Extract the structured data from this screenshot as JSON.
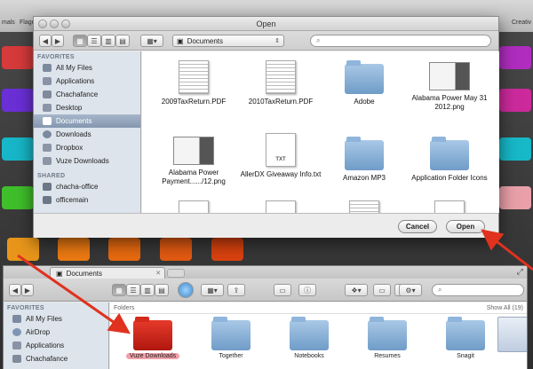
{
  "desktop": {
    "top_labels": [
      "mals",
      "Flage",
      "Creativ"
    ]
  },
  "dialog": {
    "title": "Open",
    "location": "Documents",
    "search_placeholder": "",
    "sidebar": {
      "favorites_header": "FAVORITES",
      "favorites": [
        {
          "label": "All My Files",
          "icon": "all-files-icon",
          "color": "#7c8aa0"
        },
        {
          "label": "Applications",
          "icon": "applications-icon",
          "color": "#8a93a6"
        },
        {
          "label": "Chachafance",
          "icon": "home-icon",
          "color": "#7f8b9a"
        },
        {
          "label": "Desktop",
          "icon": "desktop-icon",
          "color": "#8b95a5"
        },
        {
          "label": "Documents",
          "icon": "documents-icon",
          "color": "#ffffff"
        },
        {
          "label": "Downloads",
          "icon": "downloads-icon",
          "color": "#7c8aa0"
        },
        {
          "label": "Dropbox",
          "icon": "dropbox-icon",
          "color": "#8b95a5"
        },
        {
          "label": "Vuze Downloads",
          "icon": "folder-icon",
          "color": "#8b95a5"
        }
      ],
      "shared_header": "SHARED",
      "shared": [
        {
          "label": "chacha-office",
          "icon": "computer-icon"
        },
        {
          "label": "officemain",
          "icon": "computer-icon"
        }
      ]
    },
    "files": [
      {
        "name": "2009TaxReturn.PDF",
        "kind": "doc"
      },
      {
        "name": "2010TaxReturn.PDF",
        "kind": "doc"
      },
      {
        "name": "Adobe",
        "kind": "folder"
      },
      {
        "name": "Alabama Power May 31 2012.png",
        "kind": "png"
      },
      {
        "name": "Alabama Power Payment....../12.png",
        "kind": "png"
      },
      {
        "name": "AllerDX Giveaway Info.txt",
        "kind": "txt"
      },
      {
        "name": "Amazon MP3",
        "kind": "folder"
      },
      {
        "name": "Application Folder Icons",
        "kind": "folder"
      },
      {
        "name": "",
        "kind": "txt"
      },
      {
        "name": "",
        "kind": "doc"
      },
      {
        "name": "",
        "kind": "doc"
      },
      {
        "name": "",
        "kind": "txt"
      }
    ],
    "txt_badge": "TXT",
    "cancel_label": "Cancel",
    "open_label": "Open"
  },
  "finder": {
    "tab_title": "Documents",
    "section_label": "Folders",
    "show_all": "Show All (19)",
    "sidebar_header": "FAVORITES",
    "sidebar_items": [
      {
        "label": "All My Files",
        "icon": "all-files-icon"
      },
      {
        "label": "AirDrop",
        "icon": "airdrop-icon"
      },
      {
        "label": "Applications",
        "icon": "applications-icon"
      },
      {
        "label": "Chachafance",
        "icon": "home-icon"
      }
    ],
    "folders": [
      {
        "name": "Vuze Downloads",
        "highlight": true
      },
      {
        "name": "Together",
        "highlight": false
      },
      {
        "name": "Notebooks",
        "highlight": false
      },
      {
        "name": "Resumes",
        "highlight": false
      },
      {
        "name": "Snagit",
        "highlight": false
      }
    ]
  },
  "colors": {
    "annotation_arrow": "#e0321f",
    "selected_sidebar": "#8497b0"
  }
}
